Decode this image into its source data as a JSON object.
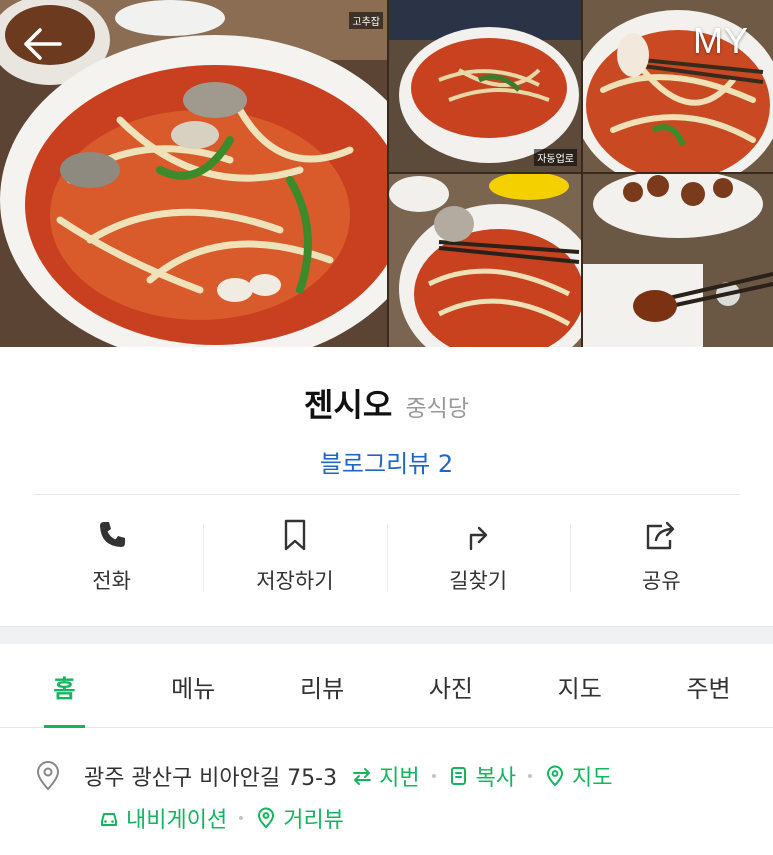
{
  "header": {
    "my_label": "MY"
  },
  "gallery": {
    "main_tag": "고추잡",
    "thumb_tag": "자동업로"
  },
  "place": {
    "name": "젠시오",
    "category": "중식당",
    "blog_review": "블로그리뷰 2"
  },
  "actions": [
    {
      "label": "전화",
      "icon": "phone-icon"
    },
    {
      "label": "저장하기",
      "icon": "bookmark-icon"
    },
    {
      "label": "길찾기",
      "icon": "directions-icon"
    },
    {
      "label": "공유",
      "icon": "share-icon"
    }
  ],
  "tabs": [
    {
      "label": "홈",
      "active": true
    },
    {
      "label": "메뉴"
    },
    {
      "label": "리뷰"
    },
    {
      "label": "사진"
    },
    {
      "label": "지도"
    },
    {
      "label": "주변"
    }
  ],
  "address": {
    "text": "광주 광산구 비아안길 75-3",
    "lot_number_link": "지번",
    "copy_link": "복사",
    "map_link": "지도",
    "navigation_link": "내비게이션",
    "street_view_link": "거리뷰"
  },
  "colors": {
    "accent_green": "#15b560",
    "link_blue": "#1f66c9"
  }
}
